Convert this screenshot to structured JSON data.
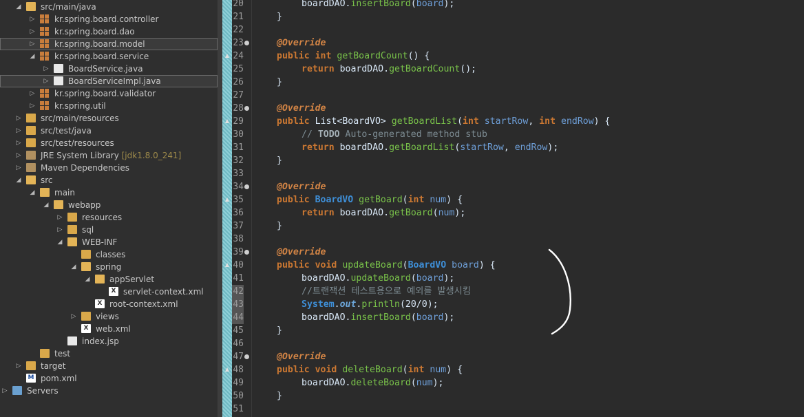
{
  "explorer": {
    "items": [
      {
        "label": "src/main/java",
        "decoration": "",
        "icon": "folder-icon",
        "expanded": true
      },
      {
        "label": "kr.spring.board.controller",
        "decoration": "",
        "icon": "package-icon",
        "expanded": false
      },
      {
        "label": "kr.spring.board.dao",
        "decoration": "",
        "icon": "package-icon",
        "expanded": false
      },
      {
        "label": "kr.spring.board.model",
        "decoration": "",
        "icon": "package-icon",
        "expanded": false
      },
      {
        "label": "kr.spring.board.service",
        "decoration": "",
        "icon": "package-icon",
        "expanded": true
      },
      {
        "label": "BoardService.java",
        "decoration": "",
        "icon": "java-file-icon",
        "expanded": false
      },
      {
        "label": "BoardServiceImpl.java",
        "decoration": "",
        "icon": "java-file-icon",
        "expanded": false
      },
      {
        "label": "kr.spring.board.validator",
        "decoration": "",
        "icon": "package-icon",
        "expanded": false
      },
      {
        "label": "kr.spring.util",
        "decoration": "",
        "icon": "package-icon",
        "expanded": false
      },
      {
        "label": "src/main/resources",
        "decoration": "",
        "icon": "folder-icon",
        "expanded": false
      },
      {
        "label": "src/test/java",
        "decoration": "",
        "icon": "folder-icon",
        "expanded": false
      },
      {
        "label": "src/test/resources",
        "decoration": "",
        "icon": "folder-icon",
        "expanded": false
      },
      {
        "label": "JRE System Library",
        "decoration": "[jdk1.8.0_241]",
        "icon": "library-icon",
        "expanded": false
      },
      {
        "label": "Maven Dependencies",
        "decoration": "",
        "icon": "library-icon",
        "expanded": false
      },
      {
        "label": "src",
        "decoration": "",
        "icon": "folder-icon",
        "expanded": true
      },
      {
        "label": "main",
        "decoration": "",
        "icon": "folder-icon",
        "expanded": true
      },
      {
        "label": "webapp",
        "decoration": "",
        "icon": "folder-icon",
        "expanded": true
      },
      {
        "label": "resources",
        "decoration": "",
        "icon": "folder-icon",
        "expanded": false
      },
      {
        "label": "sql",
        "decoration": "",
        "icon": "folder-icon",
        "expanded": false
      },
      {
        "label": "WEB-INF",
        "decoration": "",
        "icon": "folder-icon",
        "expanded": true
      },
      {
        "label": "classes",
        "decoration": "",
        "icon": "folder-icon",
        "expanded": false
      },
      {
        "label": "spring",
        "decoration": "",
        "icon": "folder-icon",
        "expanded": true
      },
      {
        "label": "appServlet",
        "decoration": "",
        "icon": "folder-icon",
        "expanded": true
      },
      {
        "label": "servlet-context.xml",
        "decoration": "",
        "icon": "xml-file-icon",
        "expanded": false
      },
      {
        "label": "root-context.xml",
        "decoration": "",
        "icon": "xml-file-icon",
        "expanded": false
      },
      {
        "label": "views",
        "decoration": "",
        "icon": "folder-icon",
        "expanded": false
      },
      {
        "label": "web.xml",
        "decoration": "",
        "icon": "xml-file-icon",
        "expanded": false
      },
      {
        "label": "index.jsp",
        "decoration": "",
        "icon": "jsp-file-icon",
        "expanded": false
      },
      {
        "label": "test",
        "decoration": "",
        "icon": "folder-icon",
        "expanded": false
      },
      {
        "label": "target",
        "decoration": "",
        "icon": "folder-icon",
        "expanded": false
      },
      {
        "label": "pom.xml",
        "decoration": "",
        "icon": "maven-file-icon",
        "expanded": false
      },
      {
        "label": "Servers",
        "decoration": "",
        "icon": "server-folder-icon",
        "expanded": false
      }
    ]
  },
  "editor": {
    "line_numbers": [
      "20",
      "21",
      "22",
      "23",
      "24",
      "25",
      "26",
      "27",
      "28",
      "29",
      "30",
      "31",
      "32",
      "33",
      "34",
      "35",
      "36",
      "37",
      "38",
      "39",
      "40",
      "41",
      "42",
      "43",
      "44",
      "45",
      "46",
      "47",
      "48",
      "49",
      "50",
      "51"
    ],
    "lines": [
      "boardDAO.insertBoard(board);",
      "}",
      "",
      "@Override",
      "public int getBoardCount() {",
      "return boardDAO.getBoardCount();",
      "}",
      "",
      "@Override",
      "public List<BoardVO> getBoardList(int startRow, int endRow) {",
      "// TODO Auto-generated method stub",
      "return boardDAO.getBoardList(startRow, endRow);",
      "}",
      "",
      "@Override",
      "public BoardVO getBoard(int num) {",
      "return boardDAO.getBoard(num);",
      "}",
      "",
      "@Override",
      "public void updateBoard(BoardVO board) {",
      "boardDAO.updateBoard(board);",
      "//트랜잭션 테스트용으로 예외를 발생시킴",
      "System.out.println(20/0);",
      "boardDAO.insertBoard(board);",
      "}",
      "",
      "@Override",
      "public void deleteBoard(int num) {",
      "boardDAO.deleteBoard(num);",
      "}",
      ""
    ]
  },
  "colors": {
    "keyword": "#cc7832",
    "annotation": "#d28445",
    "method": "#79c24a",
    "type": "#3e8fd8",
    "comment": "#7d8c93",
    "editor_bg": "#2b2b2b",
    "explorer_bg": "#2f2f2f"
  }
}
